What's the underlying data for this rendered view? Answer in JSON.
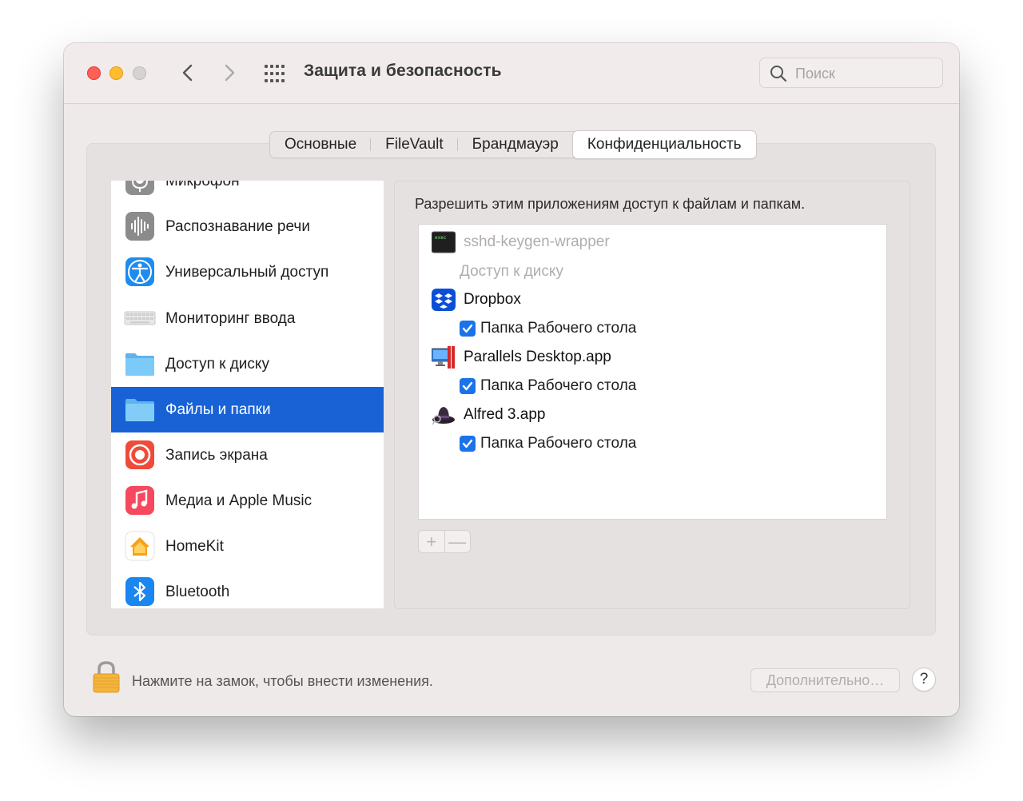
{
  "window": {
    "title": "Защита и безопасность",
    "search_placeholder": "Поиск"
  },
  "tabs": [
    {
      "label": "Основные",
      "active": false
    },
    {
      "label": "FileVault",
      "active": false
    },
    {
      "label": "Брандмауэр",
      "active": false
    },
    {
      "label": "Конфиденциальность",
      "active": true
    }
  ],
  "sidebar": {
    "items": [
      {
        "label": "Микрофон",
        "icon": "microphone-icon"
      },
      {
        "label": "Распознавание речи",
        "icon": "speech-recognition-icon"
      },
      {
        "label": "Универсальный доступ",
        "icon": "accessibility-icon"
      },
      {
        "label": "Мониторинг ввода",
        "icon": "keyboard-icon"
      },
      {
        "label": "Доступ к диску",
        "icon": "folder-icon"
      },
      {
        "label": "Файлы и папки",
        "icon": "folder-icon",
        "selected": true
      },
      {
        "label": "Запись экрана",
        "icon": "screen-recording-icon"
      },
      {
        "label": "Медиа и Apple Music",
        "icon": "music-note-icon"
      },
      {
        "label": "HomeKit",
        "icon": "home-icon"
      },
      {
        "label": "Bluetooth",
        "icon": "bluetooth-icon"
      }
    ]
  },
  "content": {
    "heading": "Разрешить этим приложениям доступ к файлам и папкам.",
    "apps": [
      {
        "name": "sshd-keygen-wrapper",
        "icon": "terminal-icon",
        "dimmed": true,
        "permission": "Доступ к диску",
        "checked": null
      },
      {
        "name": "Dropbox",
        "icon": "dropbox-icon",
        "dimmed": false,
        "permission": "Папка Рабочего стола",
        "checked": true
      },
      {
        "name": "Parallels Desktop.app",
        "icon": "parallels-icon",
        "dimmed": false,
        "permission": "Папка Рабочего стола",
        "checked": true
      },
      {
        "name": "Alfred 3.app",
        "icon": "alfred-icon",
        "dimmed": false,
        "permission": "Папка Рабочего стола",
        "checked": true
      }
    ],
    "add_label": "+",
    "remove_label": "—"
  },
  "footer": {
    "lock_text": "Нажмите на замок, чтобы внести изменения.",
    "advanced_label": "Дополнительно…",
    "help_label": "?"
  },
  "colors": {
    "selection": "#1862d6",
    "checkbox": "#1a73e8"
  }
}
